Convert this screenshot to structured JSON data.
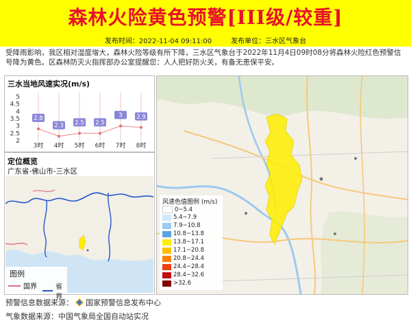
{
  "title": "森林火险黄色预警[III级/较重]",
  "meta": {
    "time_label": "发布时间：",
    "time": "2022-11-04 09:11:00",
    "unit_label": "发布单位：",
    "unit": "三水区气象台"
  },
  "description": "受降雨影响，我区相对湿度增大，森林火险等级有所下降，三水区气象台于2022年11月4日09时08分将森林火险红色预警信号降为黄色。区森林防灭火指挥部办公室提醒您：人人把好防火关，有备无患保平安。",
  "wind_panel": {
    "title": "三水当地风速实况(m/s)"
  },
  "chart_data": {
    "type": "line",
    "title": "三水当地风速实况(m/s)",
    "categories": [
      "3时",
      "4时",
      "5时",
      "6时",
      "7时",
      "8时"
    ],
    "values": [
      2.8,
      2.3,
      2.5,
      2.5,
      3,
      2.9
    ],
    "ylim": [
      2,
      5
    ],
    "yticks": [
      "5",
      "4.5",
      "4",
      "3.5",
      "3",
      "2.5",
      "2"
    ]
  },
  "location": {
    "title": "定位概览",
    "region": "广东省-佛山市-三水区"
  },
  "map_legend": {
    "title": "图例",
    "items": [
      {
        "label": "国界",
        "color": "#e06b8b"
      },
      {
        "label": "省界",
        "color": "#2255cc"
      }
    ]
  },
  "wind_legend": {
    "title": "风速色值图例 (m/s)",
    "items": [
      {
        "label": "0~5.4",
        "color": "#ffffff"
      },
      {
        "label": "5.4~7.9",
        "color": "#cfe8fb"
      },
      {
        "label": "7.9~10.8",
        "color": "#9ccbf2"
      },
      {
        "label": "10.8~13.8",
        "color": "#5aa3e6"
      },
      {
        "label": "13.8~17.1",
        "color": "#ffee00"
      },
      {
        "label": "17.1~20.8",
        "color": "#ffc000"
      },
      {
        "label": "20.8~24.4",
        "color": "#ff8000"
      },
      {
        "label": "24.4~28.4",
        "color": "#f04010"
      },
      {
        "label": "28.4~32.6",
        "color": "#c01010"
      },
      {
        "label": ">32.6",
        "color": "#800000"
      }
    ]
  },
  "footer": {
    "source1_label": "预警信息数据来源：",
    "source1": "国家预警信息发布中心",
    "source2_label": "气象数据来源：",
    "source2": "中国气象局全国自动站实况"
  }
}
